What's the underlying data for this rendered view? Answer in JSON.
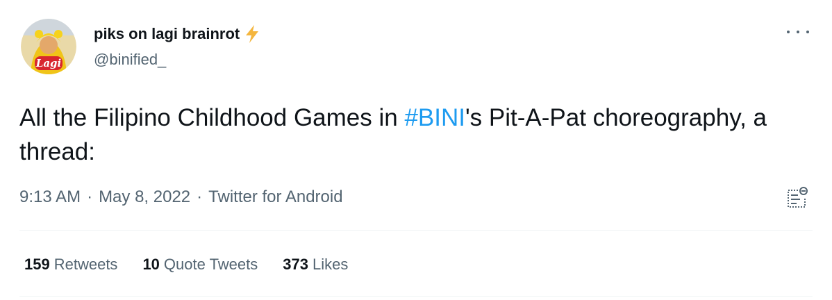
{
  "author": {
    "display_name": "piks on lagi brainrot",
    "handle": "@binified_",
    "avatar_text": "Lagi",
    "emoji_icon": "lightning-bolt-icon"
  },
  "tweet": {
    "text_before": "All the Filipino Childhood Games in ",
    "hashtag": "#BINI",
    "text_after": "'s Pit-A-Pat choreography, a thread:"
  },
  "meta": {
    "time": "9:13 AM",
    "date": "May 8, 2022",
    "source": "Twitter for Android",
    "separator": "·"
  },
  "stats": {
    "retweets_count": "159",
    "retweets_label": "Retweets",
    "quotes_count": "10",
    "quotes_label": "Quote Tweets",
    "likes_count": "373",
    "likes_label": "Likes"
  },
  "colors": {
    "link": "#1d9bf0",
    "text": "#0f1419",
    "secondary": "#536471",
    "divider": "#eff3f4",
    "bolt": "#f4b63f"
  }
}
